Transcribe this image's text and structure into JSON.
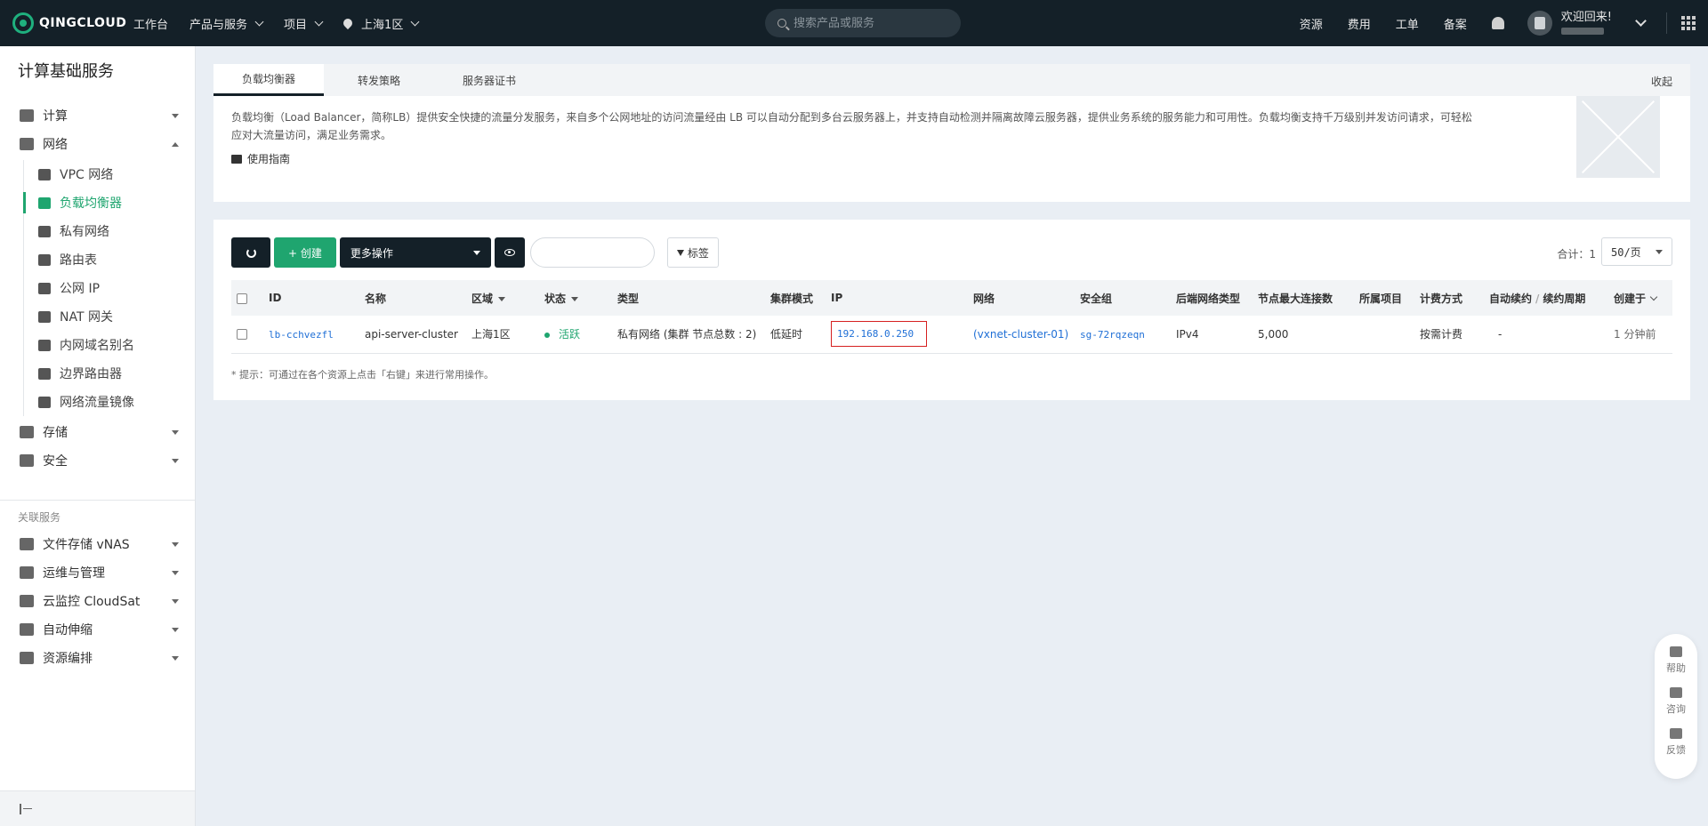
{
  "topbar": {
    "logo_text": "QINGCLOUD",
    "nav": [
      "工作台",
      "产品与服务",
      "项目"
    ],
    "region": "上海1区",
    "search_placeholder": "搜索产品或服务",
    "right_links": [
      "资源",
      "费用",
      "工单",
      "备案"
    ],
    "welcome": "欢迎回来!"
  },
  "sidebar": {
    "title": "计算基础服务",
    "groups": {
      "compute": "计算",
      "network": "网络",
      "storage": "存储",
      "security": "安全"
    },
    "network_items": [
      "VPC 网络",
      "负载均衡器",
      "私有网络",
      "路由表",
      "公网 IP",
      "NAT 网关",
      "内网域名别名",
      "边界路由器",
      "网络流量镜像"
    ],
    "related_title": "关联服务",
    "related": [
      "文件存储 vNAS",
      "运维与管理",
      "云监控 CloudSat",
      "自动伸缩",
      "资源编排"
    ]
  },
  "tabs": [
    "负载均衡器",
    "转发策略",
    "服务器证书"
  ],
  "collapse_label": "收起",
  "intro_text": "负载均衡（Load Balancer，简称LB）提供安全快捷的流量分发服务，来自多个公网地址的访问流量经由 LB 可以自动分配到多台云服务器上，并支持自动检测并隔离故障云服务器，提供业务系统的服务能力和可用性。负载均衡支持千万级别并发访问请求，可轻松应对大流量访问，满足业务需求。",
  "guide_label": "使用指南",
  "toolbar": {
    "create": "+ 创建",
    "more_actions": "更多操作",
    "tag": "标签",
    "total": "合计：1",
    "per_page": "50/页"
  },
  "table": {
    "headers": {
      "id": "ID",
      "name": "名称",
      "zone": "区域",
      "status": "状态",
      "type": "类型",
      "cluster_mode": "集群模式",
      "ip": "IP",
      "network": "网络",
      "security_group": "安全组",
      "backend_type": "后端网络类型",
      "max_conn": "节点最大连接数",
      "project": "所属项目",
      "billing": "计费方式",
      "auto_renew": "自动续约",
      "renew_period": "续约周期",
      "created": "创建于"
    },
    "row": {
      "id": "lb-cchvezfl",
      "name": "api-server-cluster",
      "zone": "上海1区",
      "status": "活跃",
      "type": "私有网络 (集群 节点总数 : 2)",
      "cluster_mode": "低延时",
      "ip": "192.168.0.250",
      "network": "(vxnet-cluster-01)",
      "security_group": "sg-72rqzeqn",
      "backend_type": "IPv4",
      "max_conn": "5,000",
      "project": "",
      "billing": "按需计费",
      "auto_renew": "-",
      "created": "1 分钟前"
    }
  },
  "tip": "* 提示：可通过在各个资源上点击「右键」来进行常用操作。",
  "float_help": [
    "帮助",
    "咨询",
    "反馈"
  ],
  "colors": {
    "brand_green": "#1fa56f",
    "nav_dark": "#142028",
    "link_blue": "#1f6fd6",
    "highlight_red": "#d62020"
  }
}
